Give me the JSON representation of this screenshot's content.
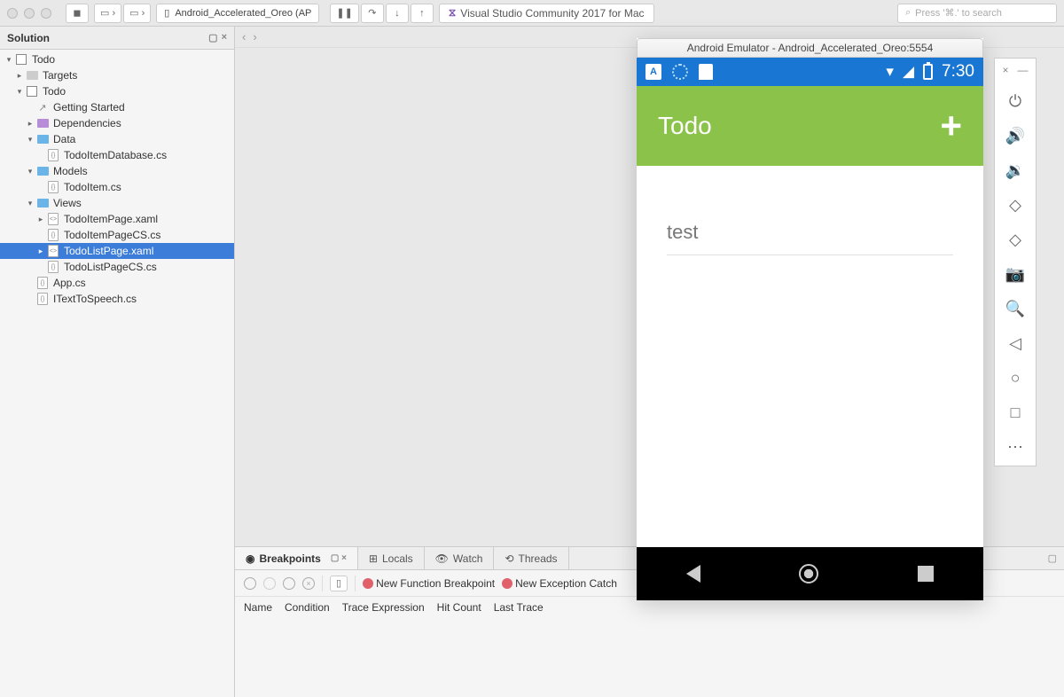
{
  "toolbar": {
    "device_label": "Android_Accelerated_Oreo (AP",
    "app_label": "Visual Studio Community 2017 for Mac",
    "search_placeholder": "Press '⌘.' to search"
  },
  "solution": {
    "panel_title": "Solution",
    "root": "Todo",
    "items": [
      {
        "label": "Targets",
        "indent": 1,
        "icon": "folder-grey",
        "toggle": "▸"
      },
      {
        "label": "Todo",
        "indent": 1,
        "icon": "sln",
        "toggle": "▾"
      },
      {
        "label": "Getting Started",
        "indent": 2,
        "icon": "arrow",
        "toggle": ""
      },
      {
        "label": "Dependencies",
        "indent": 2,
        "icon": "folder-purple",
        "toggle": "▸"
      },
      {
        "label": "Data",
        "indent": 2,
        "icon": "folder",
        "toggle": "▾"
      },
      {
        "label": "TodoItemDatabase.cs",
        "indent": 3,
        "icon": "cs",
        "toggle": ""
      },
      {
        "label": "Models",
        "indent": 2,
        "icon": "folder",
        "toggle": "▾"
      },
      {
        "label": "TodoItem.cs",
        "indent": 3,
        "icon": "cs",
        "toggle": ""
      },
      {
        "label": "Views",
        "indent": 2,
        "icon": "folder",
        "toggle": "▾"
      },
      {
        "label": "TodoItemPage.xaml",
        "indent": 3,
        "icon": "xaml",
        "toggle": "▸"
      },
      {
        "label": "TodoItemPageCS.cs",
        "indent": 3,
        "icon": "cs",
        "toggle": ""
      },
      {
        "label": "TodoListPage.xaml",
        "indent": 3,
        "icon": "xaml",
        "toggle": "▸",
        "selected": true
      },
      {
        "label": "TodoListPageCS.cs",
        "indent": 3,
        "icon": "cs",
        "toggle": ""
      },
      {
        "label": "App.cs",
        "indent": 2,
        "icon": "cs",
        "toggle": ""
      },
      {
        "label": "ITextToSpeech.cs",
        "indent": 2,
        "icon": "cs",
        "toggle": ""
      }
    ]
  },
  "bottom": {
    "tabs": [
      "Breakpoints",
      "Locals",
      "Watch",
      "Threads"
    ],
    "active_tab": "Breakpoints",
    "new_func_bp": "New Function Breakpoint",
    "new_exc_bp": "New Exception Catch",
    "headers": [
      "Name",
      "Condition",
      "Trace Expression",
      "Hit Count",
      "Last Trace"
    ]
  },
  "emulator": {
    "window_title": "Android Emulator - Android_Accelerated_Oreo:5554",
    "time": "7:30",
    "app_title": "Todo",
    "list_item": "test"
  }
}
